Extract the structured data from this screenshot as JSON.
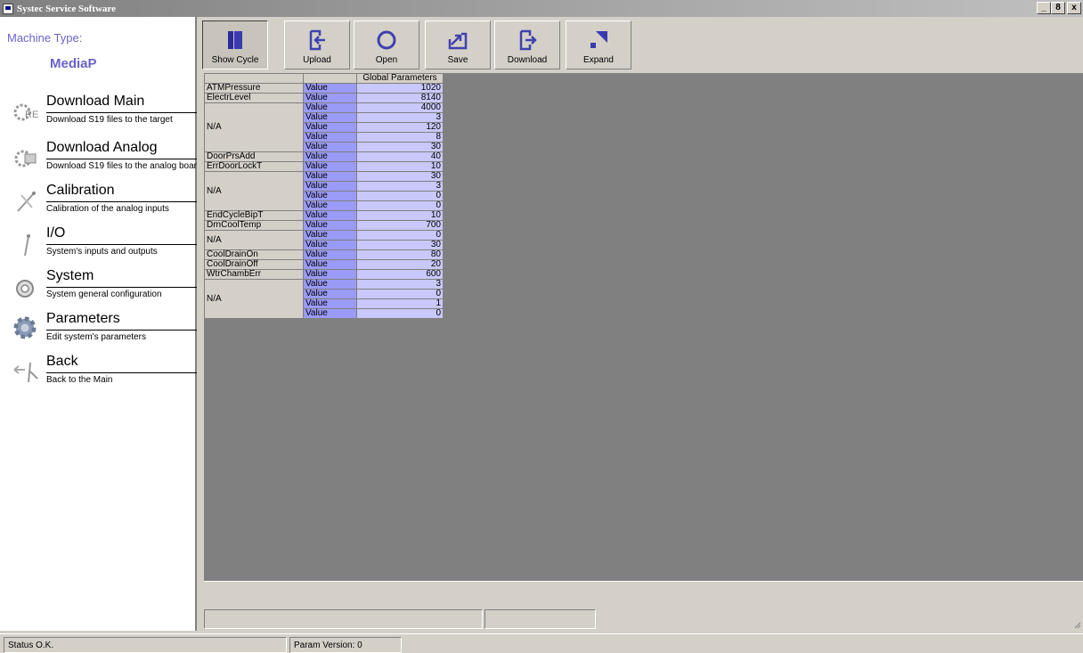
{
  "window": {
    "title": "Systec Service Software",
    "minimize": "_",
    "maximize": "8",
    "close": "x"
  },
  "sidebar": {
    "machine_type_label": "Machine Type:",
    "machine_type_value": "MediaP",
    "items": [
      {
        "label": "Download Main",
        "desc": "Download S19 files to the target",
        "icon": "download-main-icon"
      },
      {
        "label": "Download Analog",
        "desc": "Download S19 files to the analog boar",
        "icon": "download-analog-icon"
      },
      {
        "label": "Calibration",
        "desc": "Calibration of the analog inputs",
        "icon": "calibration-icon"
      },
      {
        "label": "I/O",
        "desc": "System's inputs and outputs",
        "icon": "io-icon"
      },
      {
        "label": "System",
        "desc": "System general configuration",
        "icon": "system-icon"
      },
      {
        "label": "Parameters",
        "desc": "Edit system's parameters",
        "icon": "parameters-icon"
      },
      {
        "label": "Back",
        "desc": "Back to the Main",
        "icon": "back-icon"
      }
    ]
  },
  "toolbar": {
    "buttons": [
      {
        "label": "Show Cycle",
        "icon": "show-cycle-icon"
      },
      {
        "label": "Upload",
        "icon": "upload-icon"
      },
      {
        "label": "Open",
        "icon": "open-icon"
      },
      {
        "label": "Save",
        "icon": "save-icon"
      },
      {
        "label": "Download",
        "icon": "download-icon"
      },
      {
        "label": "Expand",
        "icon": "expand-icon"
      }
    ]
  },
  "grid": {
    "column_header": "Global Parameters",
    "value_label": "Value",
    "groups": [
      {
        "name": "ATMPressure",
        "values": [
          "1020"
        ]
      },
      {
        "name": "ElectrLevel",
        "values": [
          "8140"
        ]
      },
      {
        "name": "N/A",
        "values": [
          "4000",
          "3",
          "120",
          "8",
          "30"
        ]
      },
      {
        "name": "DoorPrsAdd",
        "values": [
          "40"
        ]
      },
      {
        "name": "ErrDoorLockT",
        "values": [
          "10"
        ]
      },
      {
        "name": "N/A",
        "values": [
          "30",
          "3",
          "0",
          "0"
        ]
      },
      {
        "name": "EndCycleBipT",
        "values": [
          "10"
        ]
      },
      {
        "name": "DrnCoolTemp",
        "values": [
          "700"
        ]
      },
      {
        "name": "N/A",
        "values": [
          "0",
          "30"
        ]
      },
      {
        "name": "CoolDrainOn",
        "values": [
          "80"
        ]
      },
      {
        "name": "CoolDrainOff",
        "values": [
          "20"
        ]
      },
      {
        "name": "WtrChambErr",
        "values": [
          "600"
        ]
      },
      {
        "name": "N/A",
        "values": [
          "3",
          "0",
          "1",
          "0"
        ]
      }
    ]
  },
  "statusbar": {
    "status": "Status O.K.",
    "param_version": "Param Version: 0"
  },
  "colors": {
    "accent": "#6b62c9",
    "value_label_bg": "#9a9af7",
    "value_bg": "#c8c8fb"
  }
}
